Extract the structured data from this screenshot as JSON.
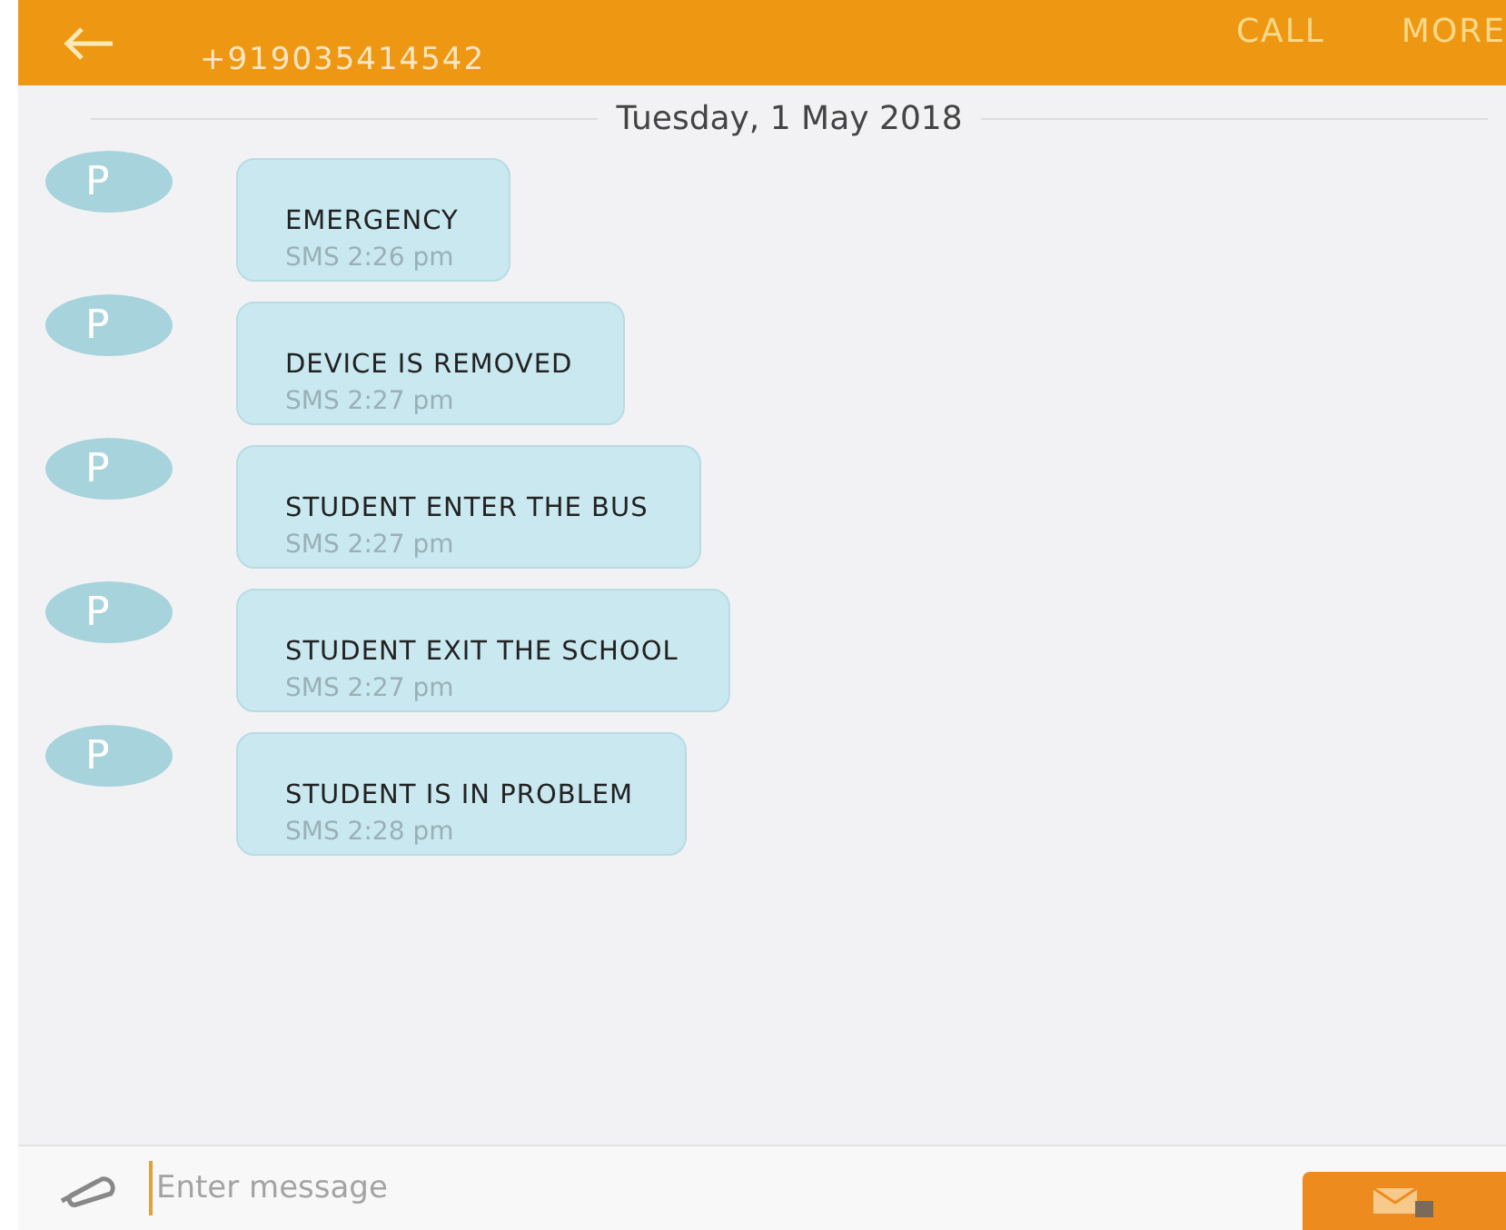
{
  "header": {
    "phone": "+919035414542",
    "actions": [
      "CALL",
      "MORE"
    ]
  },
  "date_divider": "Tuesday, 1 May 2018",
  "messages": [
    {
      "avatar": "P",
      "text": "EMERGENCY",
      "meta": "SMS 2:26 pm"
    },
    {
      "avatar": "P",
      "text": "DEVICE IS REMOVED",
      "meta": "SMS 2:27 pm"
    },
    {
      "avatar": "P",
      "text": "STUDENT ENTER THE BUS",
      "meta": "SMS 2:27 pm"
    },
    {
      "avatar": "P",
      "text": "STUDENT EXIT THE SCHOOL",
      "meta": "SMS 2:27 pm"
    },
    {
      "avatar": "P",
      "text": "STUDENT IS IN PROBLEM",
      "meta": "SMS 2:28 pm"
    }
  ],
  "composer": {
    "placeholder": "Enter message"
  }
}
